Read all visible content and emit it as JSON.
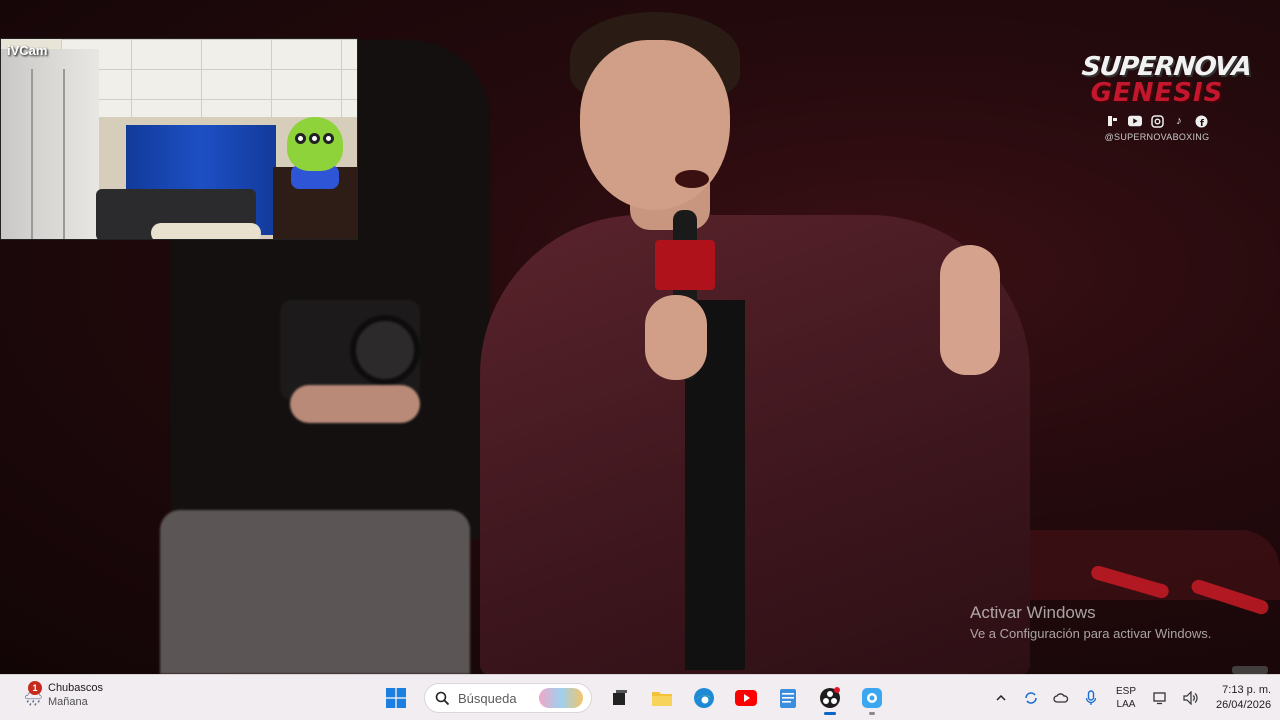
{
  "overlay": {
    "ivcam_label": "iVCam"
  },
  "brand": {
    "top": "SUPERNOVA",
    "sub": "GENESIS",
    "handle": "@SUPERNOVABOXING",
    "social_icons": [
      "kick-icon",
      "youtube-icon",
      "instagram-icon",
      "tiktok-icon",
      "facebook-icon"
    ]
  },
  "watermark": {
    "title": "Activar Windows",
    "subtitle": "Ve a Configuración para activar Windows."
  },
  "taskbar": {
    "weather": {
      "badge": "1",
      "line1": "Chubascos",
      "line2": "Mañana"
    },
    "search_placeholder": "Búsqueda",
    "apps": [
      "start-icon",
      "search",
      "task-view-icon",
      "file-explorer-icon",
      "edge-icon",
      "youtube-app-icon",
      "notepad-icon",
      "obs-icon",
      "ivcam-app-icon"
    ],
    "tray": {
      "lang_line1": "ESP",
      "lang_line2": "LAA",
      "time": "7:13 p. m.",
      "date": "26/04/2026"
    }
  },
  "colors": {
    "accent": "#0a64c4",
    "stage_red": "#c71b25",
    "brand_red": "#c4162c",
    "taskbar_bg": "#f2edf1"
  }
}
